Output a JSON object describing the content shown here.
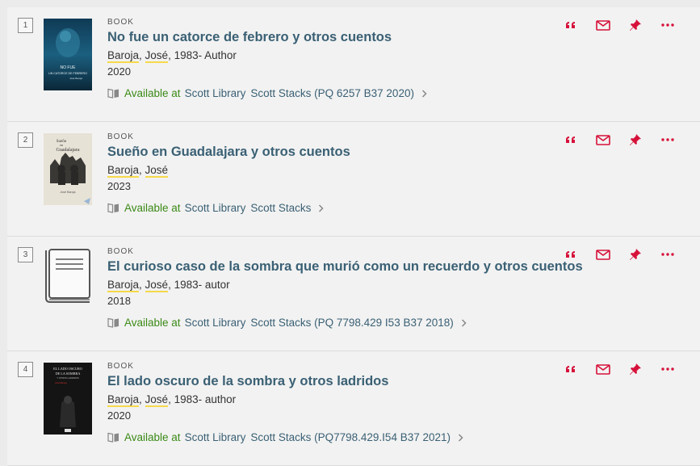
{
  "results": [
    {
      "number": "1",
      "type": "BOOK",
      "title": "No fue un catorce de febrero y otros cuentos",
      "author_last": "Baroja",
      "author_first": "José",
      "author_extra": ", 1983- Author",
      "date": "2020",
      "availability": "Available at",
      "library": "Scott Library",
      "location": "Scott Stacks (PQ 6257 B37 2020)",
      "cover_text": [
        "NO FUE",
        "UN CATORCE DE FEBRERO",
        "José Baroja"
      ]
    },
    {
      "number": "2",
      "type": "BOOK",
      "title": "Sueño en Guadalajara y otros cuentos",
      "author_last": "Baroja",
      "author_first": "José",
      "author_extra": "",
      "date": "2023",
      "availability": "Available at",
      "library": "Scott Library",
      "location": "Scott Stacks",
      "cover_text": [
        "Sueño",
        "en",
        "Guadalajara",
        "José Baroja"
      ]
    },
    {
      "number": "3",
      "type": "BOOK",
      "title": "El curioso caso de la sombra que murió como un recuerdo y otros cuentos",
      "author_last": "Baroja",
      "author_first": "José",
      "author_extra": ", 1983- autor",
      "date": "2018",
      "availability": "Available at",
      "library": "Scott Library",
      "location": "Scott Stacks (PQ 7798.429 I53 B37 2018)",
      "cover_text": []
    },
    {
      "number": "4",
      "type": "BOOK",
      "title": "El lado oscuro de la sombra y otros ladridos",
      "author_last": "Baroja",
      "author_first": "José",
      "author_extra": ", 1983- author",
      "date": "2020",
      "availability": "Available at",
      "library": "Scott Library",
      "location": "Scott Stacks (PQ7798.429.I54 B37 2021)",
      "cover_text": [
        "EL LADO OSCURO",
        "DE LA SOMBRA",
        "Y OTROS LADRIDOS",
        "José Baroja"
      ]
    }
  ],
  "icons": [
    "citation-icon",
    "email-icon",
    "pin-icon",
    "more-icon"
  ],
  "colors": {
    "accent": "#d6113a",
    "link": "#3a6074",
    "available": "#3b8a17",
    "highlight": "#f5d94a"
  }
}
